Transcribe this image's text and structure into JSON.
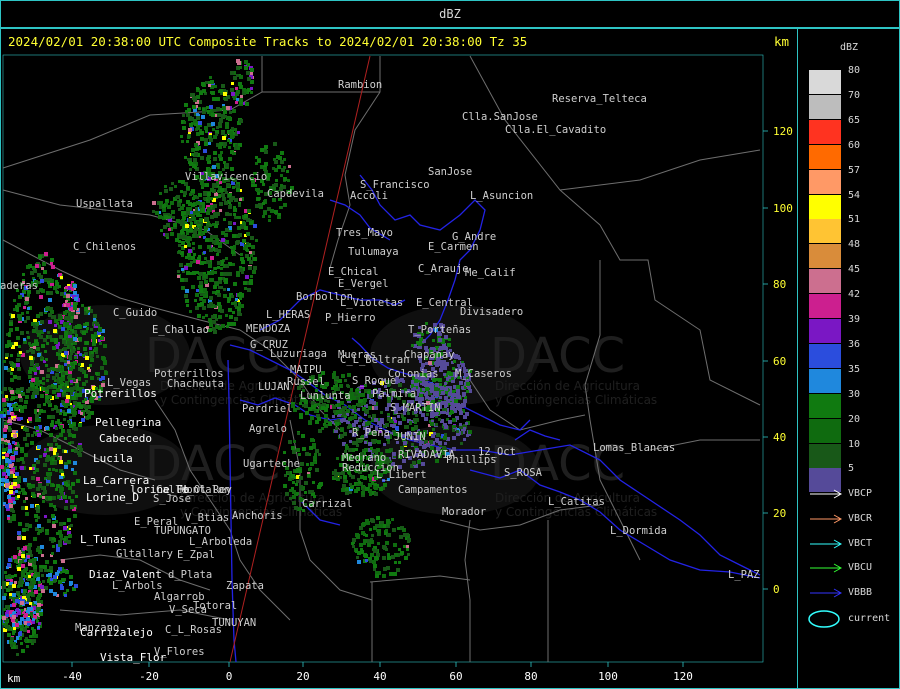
{
  "title": "dBZ",
  "header": "2024/02/01 20:38:00 UTC Composite Tracks to 2024/02/01 20:38:00 Tz 35",
  "km_top": "km",
  "km_bottom": "km",
  "legend": {
    "title": "dBZ",
    "levels": [
      {
        "label": "80",
        "color": "#d9d9d9"
      },
      {
        "label": "70",
        "color": "#bdbdbd"
      },
      {
        "label": "65",
        "color": "#ff3320"
      },
      {
        "label": "60",
        "color": "#ff6a00"
      },
      {
        "label": "57",
        "color": "#ff9966"
      },
      {
        "label": "54",
        "color": "#ffff00"
      },
      {
        "label": "51",
        "color": "#ffc433"
      },
      {
        "label": "48",
        "color": "#d98c3a"
      },
      {
        "label": "45",
        "color": "#cc6f8f"
      },
      {
        "label": "42",
        "color": "#cc1f8f"
      },
      {
        "label": "39",
        "color": "#7a17c4"
      },
      {
        "label": "36",
        "color": "#2b4ddd"
      },
      {
        "label": "35",
        "color": "#1f88dd"
      },
      {
        "label": "30",
        "color": "#107a10"
      },
      {
        "label": "20",
        "color": "#0f6b0f"
      },
      {
        "label": "10",
        "color": "#185818"
      },
      {
        "label": "5",
        "color": "#554a99"
      }
    ],
    "tracks": [
      {
        "label": "VBCP",
        "color": "#ffffff"
      },
      {
        "label": "VBCR",
        "color": "#ff9966"
      },
      {
        "label": "VBCT",
        "color": "#33ffff"
      },
      {
        "label": "VBCU",
        "color": "#33ff33"
      },
      {
        "label": "VBBB",
        "color": "#3333ff"
      }
    ],
    "current_label": "current",
    "current_color": "#33ffff"
  },
  "axes": {
    "x_ticks": [
      "-40",
      "-20",
      "0",
      "20",
      "40",
      "60",
      "80",
      "100",
      "120"
    ],
    "y_ticks": [
      "120",
      "100",
      "80",
      "60",
      "40",
      "20",
      "0"
    ]
  },
  "watermark": {
    "name": "DACC",
    "line1": "Dirección de Agricultura",
    "line2": "y Contingencias Climáticas"
  },
  "places_gray": [
    "Rambion",
    "Reserva_Telteca",
    "Clla.SanJose",
    "Clla.El_Cavadito",
    "SanJose",
    "S_Francisco",
    "Accoli",
    "L_Asuncion",
    "Tres_Mayo",
    "G_Andre",
    "E_Carmen",
    "Tulumaya",
    "E_Chical",
    "C_Arauje",
    "Me_Calif",
    "E_Vergel",
    "Borbollon",
    "L_Violetas",
    "E_Central",
    "Divisadero",
    "P_Hierro",
    "T_Porteñas",
    "L_HERAS",
    "MENDOZA",
    "G_CRUZ",
    "Luzuriaga",
    "E_Challao",
    "C_Guido",
    "Uspallata",
    "C_Chilenos",
    "Villavicencio",
    "Capdevila",
    "Mueras",
    "Chapanay",
    "C_L_Beltran",
    "Colonias",
    "M_Caseros",
    "MAIPU",
    "Russel",
    "LUJAN",
    "Lunlunta",
    "S_Roque",
    "Palmira",
    "S_MARTIN",
    "Perdriel",
    "Agrelo",
    "R_Peña",
    "JUNIN",
    "Medrano",
    "Reduccion",
    "RIVADAVIA",
    "Phillips",
    "L_Libert",
    "12_Oct",
    "Campamentos",
    "Ugarteche",
    "S_ROSA",
    "Lomas_Blancas",
    "L_Catitas",
    "Carrizal",
    "Morador",
    "Anchoris",
    "L_Dormida",
    "L_PAZ",
    "Potrerillos",
    "Chacheuta",
    "L_Vegas",
    "E_Peral",
    "V_Btias",
    "E_Zpal",
    "Gltallary",
    "d_Plata",
    "Zapata",
    "L_Arbols",
    "Algarrob",
    "V_Seca",
    "Totoral",
    "C_L_Rosas",
    "TUNUYAN",
    "Manzano",
    "V_Flores",
    "L_Arboleda",
    "TUPUNGATO",
    "S_Jose",
    "Montalon",
    "Calle_Ol_Rey",
    "L_Rey"
  ],
  "places_white": [
    "Potrerillos",
    "Pellegrina",
    "Cabecedo",
    "Lucila",
    "La_Carrera",
    "Lorine_D",
    "lorine_Fo",
    "L_Tunas",
    "Diaz_Valent",
    "Carrizalejo",
    "Vista_Flor"
  ],
  "edge_label": "aderas"
}
